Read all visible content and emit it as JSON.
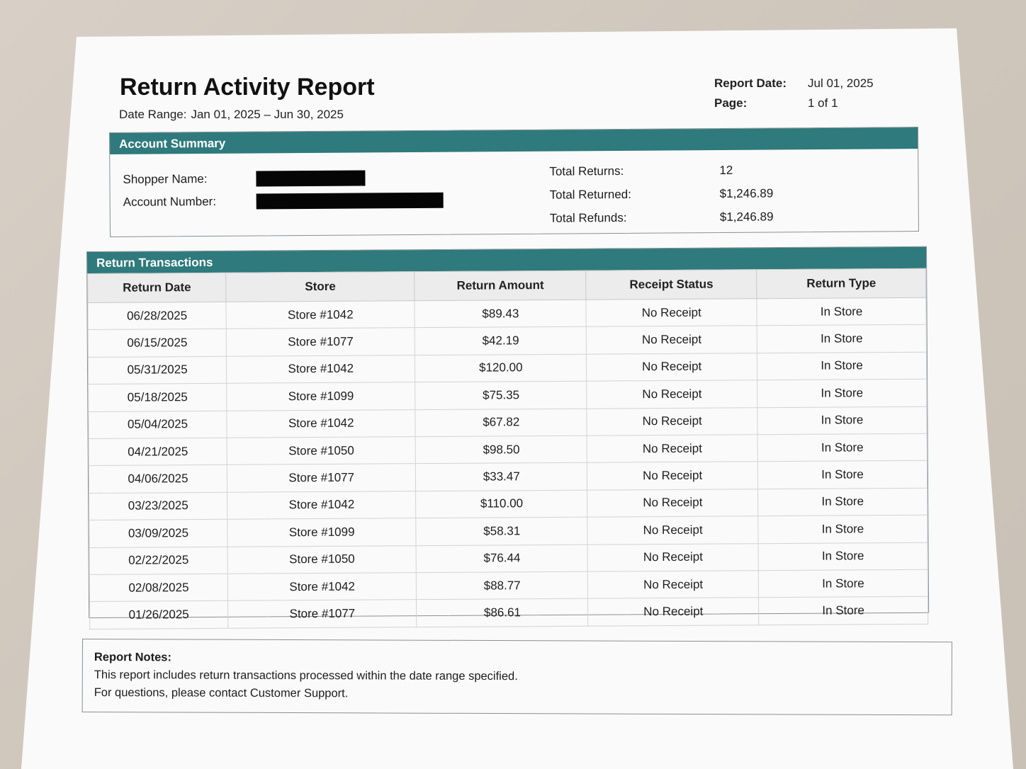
{
  "report": {
    "title": "Return Activity Report",
    "date_range_label": "Date Range:",
    "date_range_value": "Jan 01, 2025 – Jun 30, 2025",
    "report_date_label": "Report Date:",
    "report_date_value": "Jul 01, 2025",
    "page_label": "Page:",
    "page_value": "1 of 1"
  },
  "account_summary": {
    "heading": "Account Summary",
    "shopper_name_label": "Shopper Name:",
    "account_number_label": "Account Number:",
    "total_returns_label": "Total Returns:",
    "total_returns_value": "12",
    "total_returned_label": "Total Returned:",
    "total_returned_value": "$1,246.89",
    "total_refunds_label": "Total Refunds:",
    "total_refunds_value": "$1,246.89"
  },
  "transactions": {
    "heading": "Return Transactions",
    "columns": [
      "Return Date",
      "Store",
      "Return Amount",
      "Receipt Status",
      "Return Type"
    ],
    "rows": [
      [
        "06/28/2025",
        "Store #1042",
        "$89.43",
        "No Receipt",
        "In Store"
      ],
      [
        "06/15/2025",
        "Store #1077",
        "$42.19",
        "No Receipt",
        "In Store"
      ],
      [
        "05/31/2025",
        "Store #1042",
        "$120.00",
        "No Receipt",
        "In Store"
      ],
      [
        "05/18/2025",
        "Store #1099",
        "$75.35",
        "No Receipt",
        "In Store"
      ],
      [
        "05/04/2025",
        "Store #1042",
        "$67.82",
        "No Receipt",
        "In Store"
      ],
      [
        "04/21/2025",
        "Store #1050",
        "$98.50",
        "No Receipt",
        "In Store"
      ],
      [
        "04/06/2025",
        "Store #1077",
        "$33.47",
        "No Receipt",
        "In Store"
      ],
      [
        "03/23/2025",
        "Store #1042",
        "$110.00",
        "No Receipt",
        "In Store"
      ],
      [
        "03/09/2025",
        "Store #1099",
        "$58.31",
        "No Receipt",
        "In Store"
      ],
      [
        "02/22/2025",
        "Store #1050",
        "$76.44",
        "No Receipt",
        "In Store"
      ],
      [
        "02/08/2025",
        "Store #1042",
        "$88.77",
        "No Receipt",
        "In Store"
      ],
      [
        "01/26/2025",
        "Store #1077",
        "$86.61",
        "No Receipt",
        "In Store"
      ]
    ]
  },
  "notes": {
    "title": "Report Notes:",
    "line1": "This report includes return transactions processed within the date range specified.",
    "line2": "For questions, please contact Customer Support."
  },
  "colors": {
    "section_header": "#2e7a7c",
    "redaction": "#050505"
  }
}
